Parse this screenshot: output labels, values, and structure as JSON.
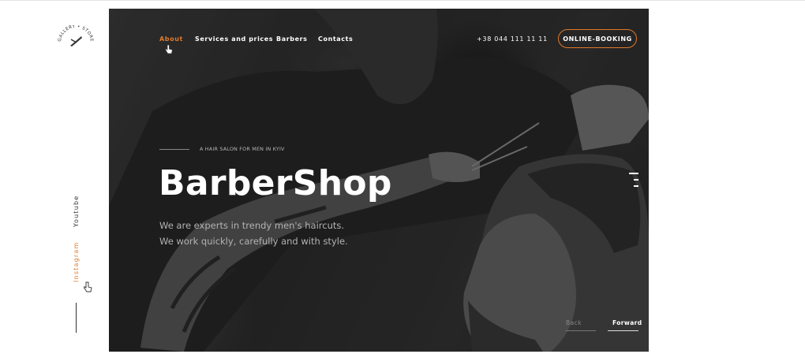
{
  "brand": {
    "logo_text": "GALLERY • STORE & MORE"
  },
  "nav": {
    "items": [
      {
        "label": "About",
        "active": true
      },
      {
        "label": "Services and prices",
        "active": false
      },
      {
        "label": "Barbers",
        "active": false
      },
      {
        "label": "Contacts",
        "active": false
      }
    ],
    "phone": "+38 044 111 11 11",
    "booking_label": "ONLINE-BOOKING"
  },
  "hero": {
    "kicker": "A HAIR SALON FOR MEN IN KYIV",
    "title": "BarberShop",
    "line1": "We are experts in trendy men's haircuts.",
    "line2": "We work quickly, carefully and with style."
  },
  "social": {
    "youtube": "Youtube",
    "instagram": "Instagram"
  },
  "slider": {
    "back_label": "Back",
    "forward_label": "Forward"
  },
  "colors": {
    "accent": "#e07a2a",
    "hero_bg": "#2f2f2f"
  }
}
